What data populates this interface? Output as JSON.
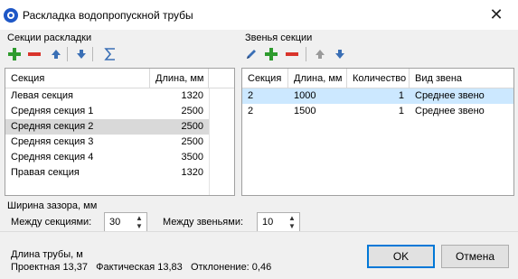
{
  "window": {
    "title": "Раскладка водопропускной трубы",
    "close_label": "✕"
  },
  "sections": {
    "group_label": "Секции раскладки",
    "columns": [
      "Секция",
      "Длина, мм"
    ],
    "rows": [
      {
        "name": "Левая секция",
        "length": "1320"
      },
      {
        "name": "Средняя секция 1",
        "length": "2500"
      },
      {
        "name": "Средняя секция 2",
        "length": "2500"
      },
      {
        "name": "Средняя секция 3",
        "length": "2500"
      },
      {
        "name": "Средняя секция 4",
        "length": "3500"
      },
      {
        "name": "Правая секция",
        "length": "1320"
      }
    ],
    "selected_index": 2,
    "toolbar_icons": [
      "add-icon",
      "remove-icon",
      "move-up-icon",
      "move-down-icon",
      "sum-icon"
    ]
  },
  "links": {
    "group_label": "Звенья секции",
    "columns": [
      "Секция",
      "Длина, мм",
      "Количество",
      "Вид звена"
    ],
    "rows": [
      {
        "section": "2",
        "length": "1000",
        "count": "1",
        "kind": "Среднее звено"
      },
      {
        "section": "2",
        "length": "1500",
        "count": "1",
        "kind": "Среднее звено"
      }
    ],
    "selected_index": 0,
    "toolbar_icons": [
      "edit-icon",
      "add-icon",
      "remove-icon",
      "move-up-icon",
      "move-down-icon"
    ]
  },
  "gap": {
    "group_label": "Ширина зазора, мм",
    "between_sections_label": "Между секциями:",
    "between_sections_value": "30",
    "between_links_label": "Между звеньями:",
    "between_links_value": "10"
  },
  "pipe": {
    "label": "Длина трубы, м",
    "summary": "Проектная 13,37   Фактическая 13,83   Отклонение: 0,46"
  },
  "buttons": {
    "ok": "OK",
    "cancel": "Отмена"
  },
  "colors": {
    "accent": "#0078d7",
    "add": "#2e9b2e",
    "remove": "#d9342b",
    "arrow": "#3a6fb5",
    "selection_blue": "#cce8ff",
    "selection_gray": "#d9d9d9"
  }
}
